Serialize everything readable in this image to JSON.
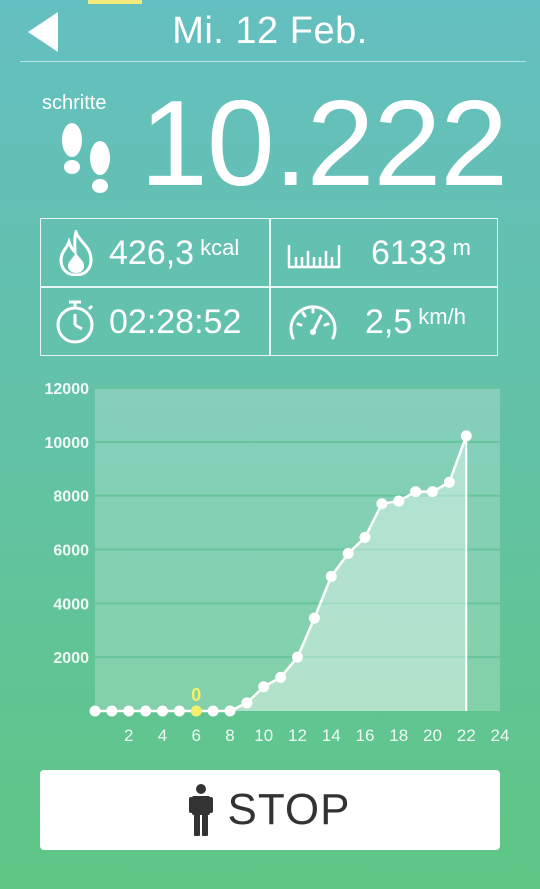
{
  "header": {
    "date": "Mi. 12 Feb."
  },
  "steps": {
    "label": "schritte",
    "value": "10.222"
  },
  "stats": {
    "calories": {
      "value": "426,3",
      "unit": "kcal"
    },
    "distance": {
      "value": "6133",
      "unit": "m"
    },
    "duration": {
      "value": "02:28:52"
    },
    "speed": {
      "value": "2,5",
      "unit": "km/h"
    }
  },
  "chart_data": {
    "type": "area",
    "x": [
      0,
      1,
      2,
      3,
      4,
      5,
      6,
      7,
      8,
      9,
      10,
      11,
      12,
      13,
      14,
      15,
      16,
      17,
      18,
      19,
      20,
      21,
      22
    ],
    "values": [
      0,
      0,
      0,
      0,
      0,
      0,
      0,
      0,
      0,
      300,
      900,
      1250,
      2000,
      3450,
      5000,
      5850,
      6450,
      7700,
      7800,
      8150,
      8150,
      8500,
      10222
    ],
    "highlight": {
      "x": 6,
      "value": 0,
      "label": "0"
    },
    "xticks": [
      2,
      4,
      6,
      8,
      10,
      12,
      14,
      16,
      18,
      20,
      22,
      24
    ],
    "yticks": [
      2000,
      4000,
      6000,
      8000,
      10000,
      12000
    ],
    "xlim": [
      0,
      24
    ],
    "ylim": [
      0,
      12000
    ],
    "grid": true,
    "colors": {
      "highlight": "#f4f06a",
      "line": "#ffffff"
    }
  },
  "stop_button": {
    "label": "STOP"
  }
}
